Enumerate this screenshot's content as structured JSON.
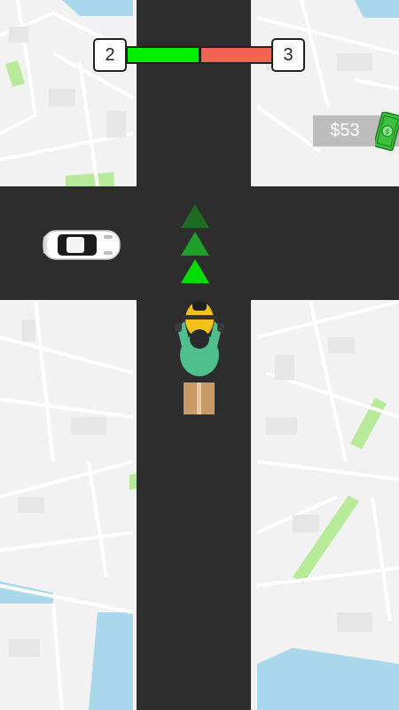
{
  "hud": {
    "level_current": "2",
    "level_next": "3",
    "progress_fraction": 0.5,
    "progress_color_done": "#00ee00",
    "progress_color_remaining": "#f26352"
  },
  "wallet": {
    "amount": "$53",
    "icon": "cash-bill-icon"
  },
  "scene": {
    "road_color": "#2d2d2d",
    "map_background": "#f2f2f2",
    "park_color": "#b7eb9a",
    "water_color": "#a9d8ec",
    "player": "delivery-scooter-rider",
    "traffic": [
      "white-car"
    ],
    "direction_arrows": 3,
    "arrow_colors": [
      "#1e6b24",
      "#1f9e2a",
      "#00dd00"
    ]
  }
}
